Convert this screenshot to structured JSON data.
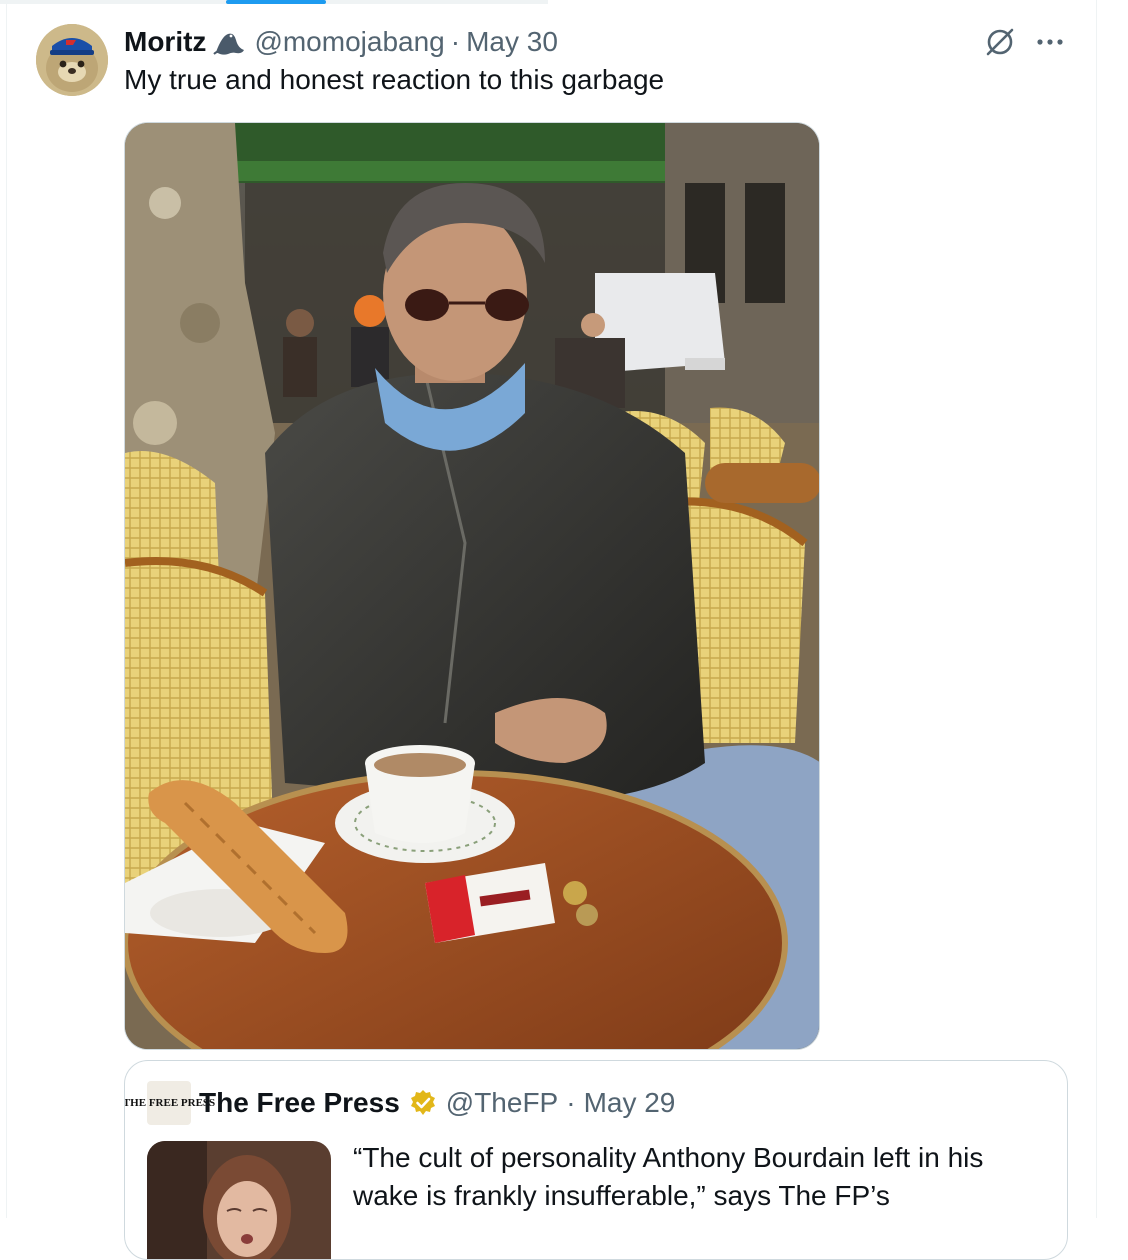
{
  "tweet": {
    "author_name": "Moritz",
    "handle": "@momojabang",
    "separator": "·",
    "date": "May 30",
    "text": "My true and honest reaction to this garbage",
    "icons": {
      "avatar": "seal-avatar-icon",
      "name_badge": "seal-icon",
      "grok": "grok-icon",
      "more": "more-icon"
    }
  },
  "quote": {
    "logo_text": "THE FREE PRESS",
    "author_name": "The Free Press",
    "verified": "gold-verified-badge",
    "handle": "@TheFP",
    "separator": "·",
    "date": "May 29",
    "text": "“The cult of personality Anthony Bourdain left in his wake is frankly insufferable,” says The FP’s"
  },
  "colors": {
    "accent": "#1d9bf0",
    "text_primary": "#0f1419",
    "text_secondary": "#536471",
    "border": "#cfd9de",
    "verified_gold": "#e2b719"
  }
}
